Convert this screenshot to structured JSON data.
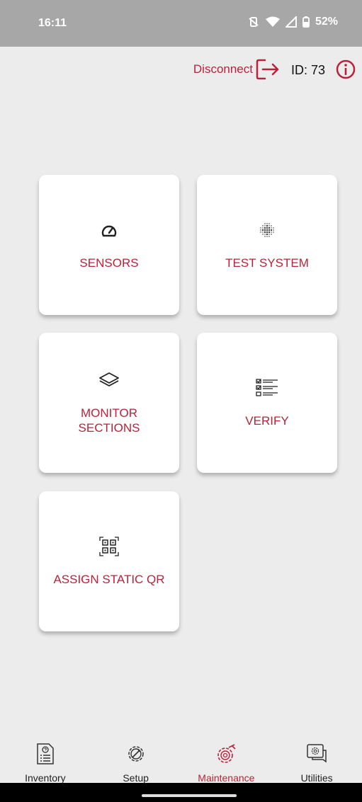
{
  "status_bar": {
    "time": "16:11",
    "battery": "52%"
  },
  "header": {
    "disconnect_label": "Disconnect",
    "device_id": "ID: 73"
  },
  "tiles": [
    {
      "label": "SENSORS",
      "icon": "gauge-icon"
    },
    {
      "label": "TEST SYSTEM",
      "icon": "dot-grid-icon"
    },
    {
      "label": "MONITOR\nSECTIONS",
      "icon": "layers-icon"
    },
    {
      "label": "VERIFY",
      "icon": "checklist-icon"
    },
    {
      "label": "ASSIGN STATIC QR",
      "icon": "qr-code-icon"
    }
  ],
  "bottom_nav": {
    "items": [
      {
        "label": "Inventory",
        "icon": "inventory-icon"
      },
      {
        "label": "Setup",
        "icon": "setup-gear-icon"
      },
      {
        "label": "Maintenance",
        "icon": "maintenance-gear-icon",
        "active": true
      },
      {
        "label": "Utilities",
        "icon": "utilities-chat-gear-icon"
      }
    ]
  },
  "colors": {
    "accent": "#b8233a",
    "status_bar": "#a7a7a7",
    "background": "#ececec"
  }
}
